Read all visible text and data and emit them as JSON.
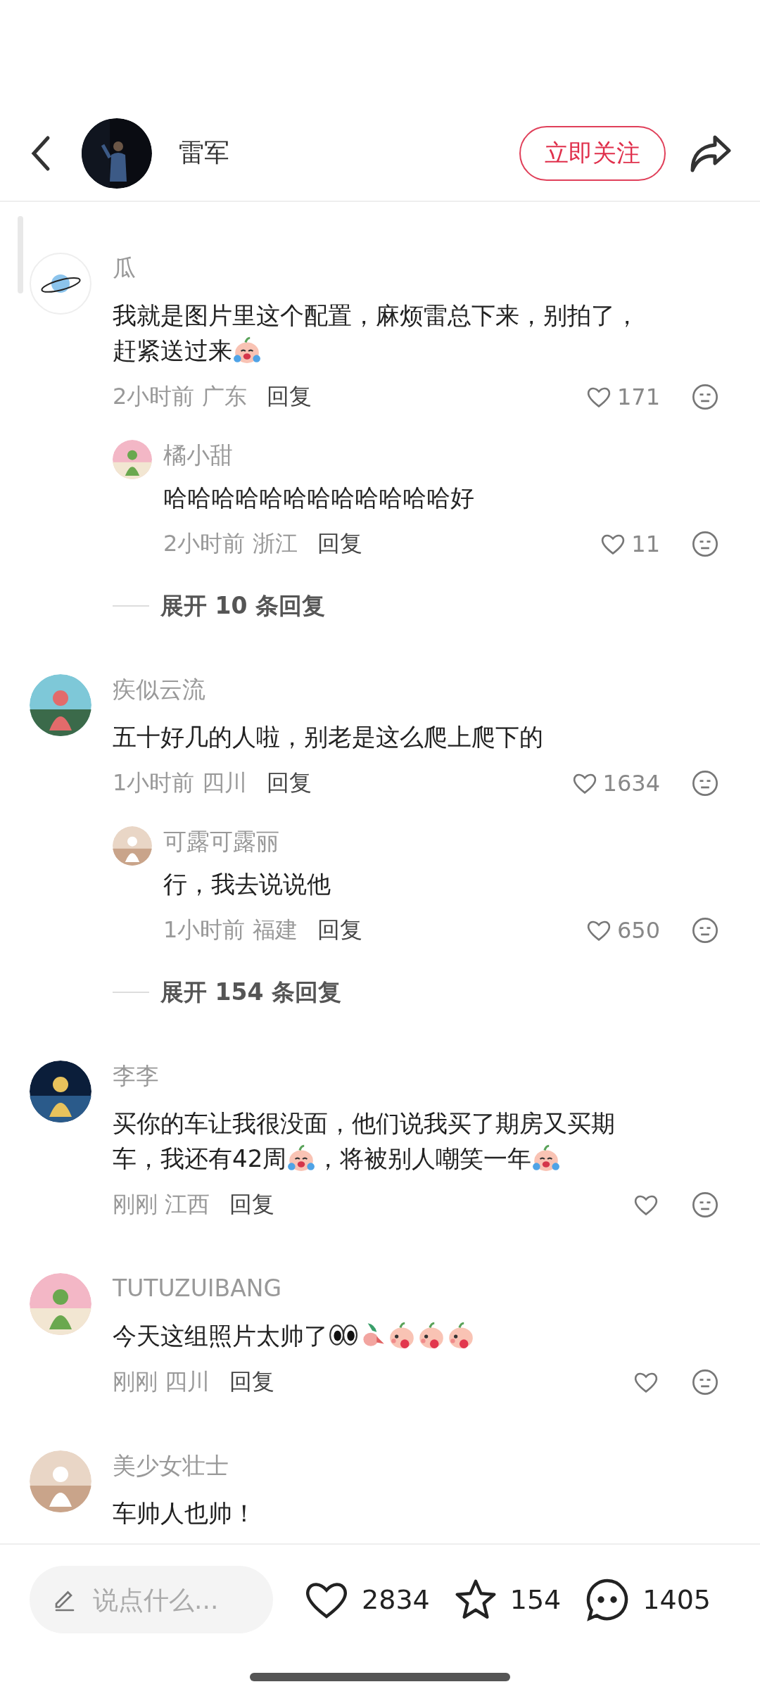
{
  "header": {
    "name": "雷军",
    "follow_button": "立即关注"
  },
  "comments": [
    {
      "kind": "planet_avatar",
      "name": "瓜",
      "lines": [
        [
          {
            "kind": "text",
            "text": "我就是图片里这个配置，麻烦雷总下来，别拍了，"
          }
        ],
        [
          {
            "kind": "text",
            "text": "赶紧送过来"
          },
          {
            "kind": "laugh_cry"
          }
        ]
      ],
      "time": "2小时前",
      "location": "广东",
      "reply_label": "回复",
      "likes": "171",
      "replies": [
        {
          "name": "橘小甜",
          "lines": [
            [
              {
                "kind": "text",
                "text": "哈哈哈哈哈哈哈哈哈哈哈哈好"
              }
            ]
          ],
          "time": "2小时前",
          "location": "浙江",
          "reply_label": "回复",
          "likes": "11"
        }
      ],
      "expand": "展开 10 条回复"
    },
    {
      "kind": "photo_avatar",
      "name": "疾似云流",
      "lines": [
        [
          {
            "kind": "text",
            "text": "五十好几的人啦，别老是这么爬上爬下的"
          }
        ]
      ],
      "time": "1小时前",
      "location": "四川",
      "reply_label": "回复",
      "likes": "1634",
      "replies": [
        {
          "name": "可露可露丽",
          "lines": [
            [
              {
                "kind": "text",
                "text": "行，我去说说他"
              }
            ]
          ],
          "time": "1小时前",
          "location": "福建",
          "reply_label": "回复",
          "likes": "650"
        }
      ],
      "expand": "展开 154 条回复"
    },
    {
      "kind": "photo_avatar",
      "name": "李李",
      "lines": [
        [
          {
            "kind": "text",
            "text": "买你的车让我很没面，他们说我买了期房又买期"
          }
        ],
        [
          {
            "kind": "text",
            "text": "车，我还有42周"
          },
          {
            "kind": "laugh_cry"
          },
          {
            "kind": "text",
            "text": "，将被别人嘲笑一年"
          },
          {
            "kind": "laugh_cry"
          }
        ]
      ],
      "time": "刚刚",
      "location": "江西",
      "reply_label": "回复"
    },
    {
      "kind": "photo_avatar",
      "name": "TUTUZUIBANG",
      "lines": [
        [
          {
            "kind": "text",
            "text": "今天这组照片太帅了"
          },
          {
            "kind": "eyes"
          },
          {
            "kind": "radish"
          },
          {
            "kind": "blush"
          },
          {
            "kind": "blush"
          },
          {
            "kind": "blush"
          }
        ]
      ],
      "time": "刚刚",
      "location": "四川",
      "reply_label": "回复"
    },
    {
      "kind": "photo_avatar",
      "name": "美少女壮士",
      "lines": [
        [
          {
            "kind": "text",
            "text": "车帅人也帅！"
          }
        ]
      ]
    }
  ],
  "bottom_bar": {
    "placeholder": "说点什么...",
    "likes": "2834",
    "favorites": "154",
    "comments": "1405"
  }
}
